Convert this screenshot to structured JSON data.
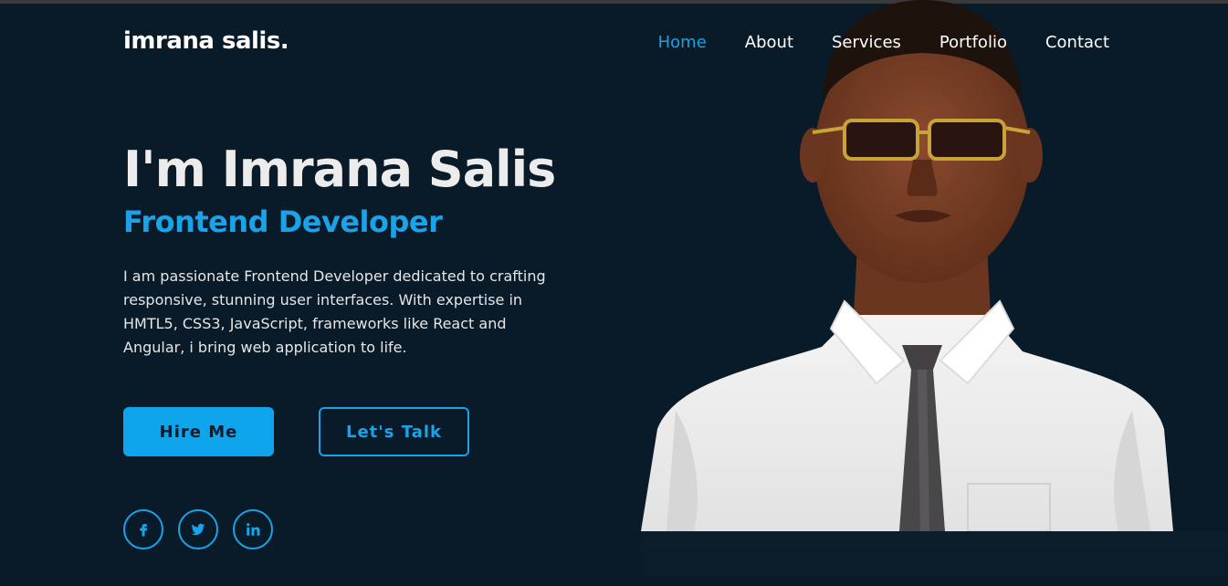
{
  "header": {
    "logo": "imrana salis.",
    "nav": [
      {
        "label": "Home",
        "active": true
      },
      {
        "label": "About",
        "active": false
      },
      {
        "label": "Services",
        "active": false
      },
      {
        "label": "Portfolio",
        "active": false
      },
      {
        "label": "Contact",
        "active": false
      }
    ]
  },
  "hero": {
    "title": "I'm Imrana Salis",
    "subtitle": "Frontend Developer",
    "description": "I am passionate Frontend Developer dedicated to crafting responsive, stunning user interfaces. With expertise in HMTL5, CSS3, JavaScript, frameworks like React and Angular, i bring web application to life."
  },
  "buttons": {
    "hire": "Hire Me",
    "talk": "Let's Talk"
  },
  "socials": [
    {
      "name": "facebook-icon"
    },
    {
      "name": "twitter-icon"
    },
    {
      "name": "linkedin-icon"
    }
  ],
  "colors": {
    "background": "#091a28",
    "accent": "#1aa3e8",
    "text": "#ffffff"
  }
}
